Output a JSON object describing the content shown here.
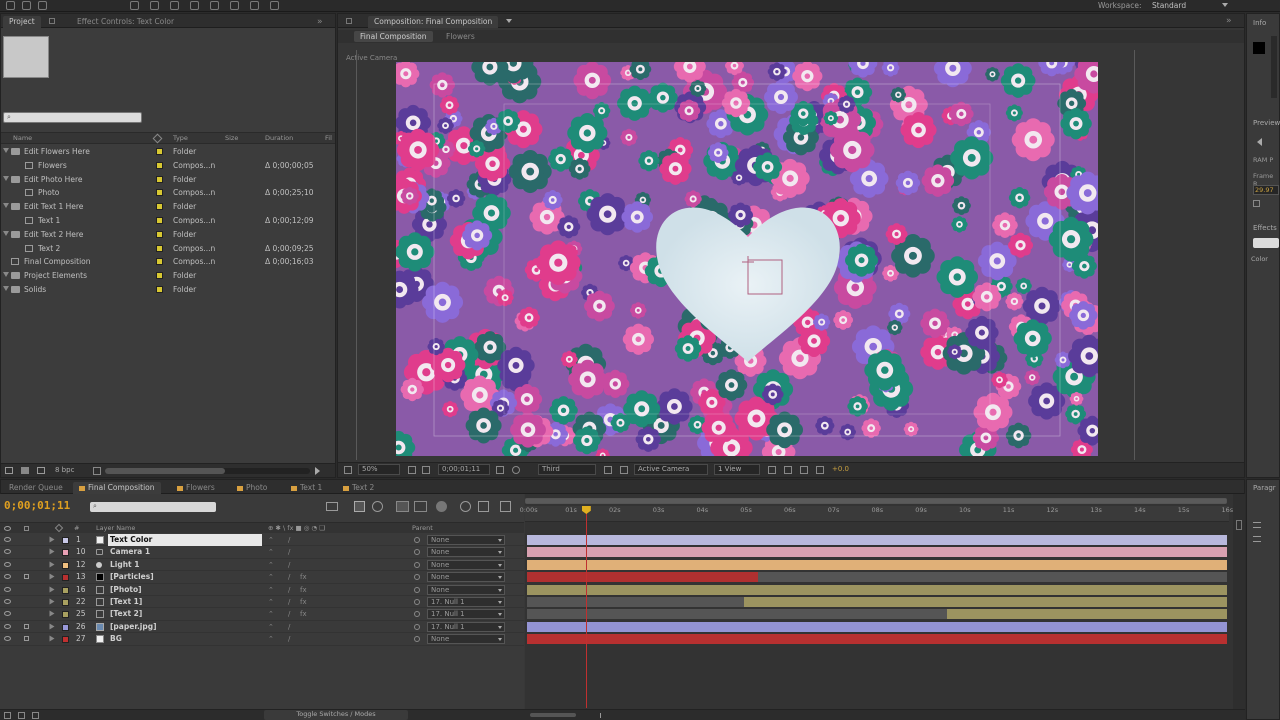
{
  "topbar": {
    "workspace_label": "Workspace:",
    "workspace_value": "Standard"
  },
  "project_panel": {
    "tabs": [
      {
        "label": "Project"
      },
      {
        "label": "Effect Controls: Text Color"
      }
    ],
    "search_placeholder": "",
    "columns": {
      "name": "Name",
      "type": "Type",
      "size": "Size",
      "duration": "Duration"
    },
    "items": [
      {
        "name": "Edit Flowers Here",
        "kind": "folder",
        "color": "#d8c832",
        "type": "Folder",
        "duration": "",
        "indent": 0
      },
      {
        "name": "Flowers",
        "kind": "comp",
        "color": "#d8c832",
        "type": "Compos...n",
        "duration": "Δ 0;00;00;05",
        "indent": 1
      },
      {
        "name": "Edit Photo Here",
        "kind": "folder",
        "color": "#d8c832",
        "type": "Folder",
        "duration": "",
        "indent": 0
      },
      {
        "name": "Photo",
        "kind": "comp",
        "color": "#d8c832",
        "type": "Compos...n",
        "duration": "Δ 0;00;25;10",
        "indent": 1
      },
      {
        "name": "Edit Text 1 Here",
        "kind": "folder",
        "color": "#d8c832",
        "type": "Folder",
        "duration": "",
        "indent": 0
      },
      {
        "name": "Text 1",
        "kind": "comp",
        "color": "#d8c832",
        "type": "Compos...n",
        "duration": "Δ 0;00;12;09",
        "indent": 1
      },
      {
        "name": "Edit Text 2 Here",
        "kind": "folder",
        "color": "#d8c832",
        "type": "Folder",
        "duration": "",
        "indent": 0
      },
      {
        "name": "Text 2",
        "kind": "comp",
        "color": "#d8c832",
        "type": "Compos...n",
        "duration": "Δ 0;00;09;25",
        "indent": 1
      },
      {
        "name": "Final Composition",
        "kind": "comp",
        "color": "#d8c832",
        "type": "Compos...n",
        "duration": "Δ 0;00;16;03",
        "indent": 0
      },
      {
        "name": "Project Elements",
        "kind": "folder",
        "color": "#d8c832",
        "type": "Folder",
        "duration": "",
        "indent": 0
      },
      {
        "name": "Solids",
        "kind": "folder",
        "color": "#d8c832",
        "type": "Folder",
        "duration": "",
        "indent": 0
      }
    ],
    "bpc": "8 bpc"
  },
  "composition_panel": {
    "title": "Composition: Final Composition",
    "subtabs": [
      {
        "label": "Final Composition"
      },
      {
        "label": "Flowers"
      }
    ],
    "camera_label": "Active Camera",
    "zoom": "50%",
    "timecode": "0;00;01;11",
    "resolution": "Third",
    "view_camera": "Active Camera",
    "views": "1 View",
    "exposure": "+0.0"
  },
  "right_panels": {
    "info": "Info",
    "preview": "Preview",
    "frame_rate_label": "Frame R...",
    "frame_rate": "29.97",
    "ram_label": "RAM P",
    "effects": "Effects",
    "effects_item": "Color",
    "paragraph": "Paragr"
  },
  "timeline": {
    "tabs": [
      {
        "label": "Render Queue",
        "color": ""
      },
      {
        "label": "Final Composition",
        "color": "#d8a040"
      },
      {
        "label": "Flowers",
        "color": "#d8a040"
      },
      {
        "label": "Photo",
        "color": "#d8a040"
      },
      {
        "label": "Text 1",
        "color": "#d8a040"
      },
      {
        "label": "Text 2",
        "color": "#d8a040"
      }
    ],
    "current_time": "0;00;01;11",
    "col_layer_name": "Layer Name",
    "col_parent": "Parent",
    "ruler": [
      "0:00s",
      "01s",
      "02s",
      "03s",
      "04s",
      "05s",
      "06s",
      "07s",
      "08s",
      "09s",
      "10s",
      "11s",
      "12s",
      "13s",
      "14s",
      "15s",
      "16s"
    ],
    "playhead_fraction": 0.084,
    "layers": [
      {
        "num": "1",
        "name": "Text Color",
        "label_color": "#c8c8e8",
        "icon": "solid-white",
        "parent": "None",
        "bar_color": "#b8b8dc",
        "start": 0.0,
        "end": 1.0,
        "selected": true
      },
      {
        "num": "10",
        "name": "Camera 1",
        "label_color": "#e8a0b4",
        "icon": "camera",
        "parent": "None",
        "bar_color": "#d8a0b0",
        "start": 0.0,
        "end": 1.0,
        "selected": false
      },
      {
        "num": "12",
        "name": "Light 1",
        "label_color": "#f0c080",
        "icon": "light",
        "parent": "None",
        "bar_color": "#e0b078",
        "start": 0.0,
        "end": 1.0,
        "selected": false
      },
      {
        "num": "13",
        "name": "[Particles]",
        "label_color": "#b83030",
        "icon": "solid-black",
        "parent": "None",
        "bar_color": "#b03030",
        "start": 0.0,
        "end": 0.33,
        "selected": false
      },
      {
        "num": "16",
        "name": "[Photo]",
        "label_color": "#a8a060",
        "icon": "comp",
        "parent": "None",
        "bar_color": "#9c9460",
        "start": 0.0,
        "end": 1.0,
        "selected": false
      },
      {
        "num": "22",
        "name": "[Text 1]",
        "label_color": "#a8a060",
        "icon": "comp",
        "parent": "17. Null 1",
        "bar_color": "#9c9460",
        "start": 0.31,
        "end": 1.0,
        "selected": false
      },
      {
        "num": "25",
        "name": "[Text 2]",
        "label_color": "#a8a060",
        "icon": "comp",
        "parent": "17. Null 1",
        "bar_color": "#9c9460",
        "start": 0.6,
        "end": 1.0,
        "selected": false
      },
      {
        "num": "26",
        "name": "[paper.jpg]",
        "label_color": "#9898d8",
        "icon": "image",
        "parent": "17. Null 1",
        "bar_color": "#9494d4",
        "start": 0.0,
        "end": 1.0,
        "selected": false
      },
      {
        "num": "27",
        "name": "BG",
        "label_color": "#c03030",
        "icon": "solid-white",
        "parent": "None",
        "bar_color": "#b83030",
        "start": 0.0,
        "end": 1.0,
        "selected": false
      }
    ],
    "toggle_label": "Toggle Switches / Modes"
  }
}
